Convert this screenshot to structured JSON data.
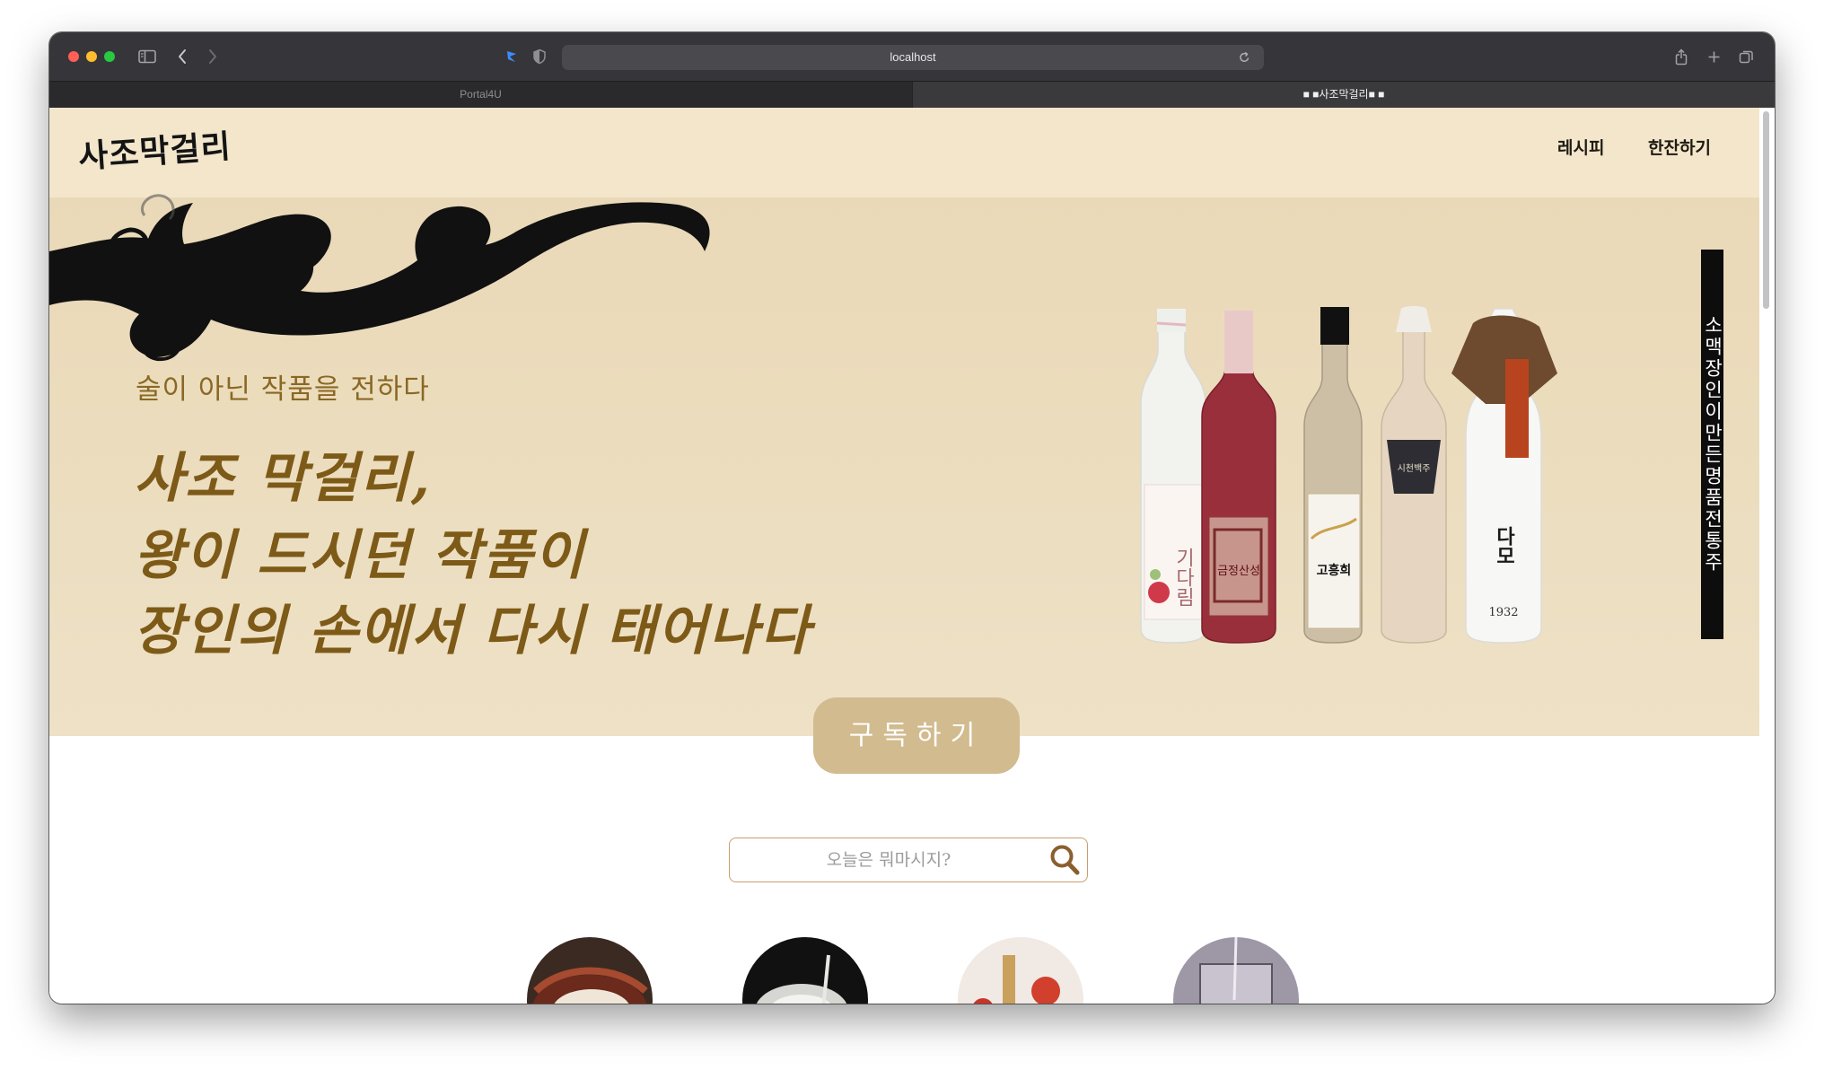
{
  "browser": {
    "url": "localhost",
    "tabs": [
      {
        "label": "Portal4U",
        "active": false
      },
      {
        "label": "■ ■사조막걸리■ ■",
        "active": true
      }
    ]
  },
  "site": {
    "logo": "사조막걸리",
    "nav": [
      {
        "label": "레시피"
      },
      {
        "label": "한잔하기"
      }
    ]
  },
  "hero": {
    "tagline": "술이 아닌 작품을 전하다",
    "headline": [
      "사조 막걸리,",
      "왕이 드시던 작품이",
      "장인의 손에서 다시 태어나다"
    ],
    "vertical_banner": "소맥장인이만든명품전통주",
    "bottle_labels": [
      "기다림",
      "금정산성",
      "고흥희",
      "시천백주",
      "1932"
    ],
    "subscribe_label": "구독하기"
  },
  "search": {
    "placeholder": "오늘은 뭐마시지?",
    "icon": "search-icon"
  },
  "categories": [
    {
      "icon": "makgeolli-bowl-photo"
    },
    {
      "icon": "pouring-cup-photo"
    },
    {
      "icon": "fruit-drinks-photo"
    },
    {
      "icon": "glass-pour-photo"
    }
  ],
  "colors": {
    "accent_gold": "#7d5a17",
    "subscribe_button": "#d1bb8f",
    "hero_background": "#ebdcbd",
    "search_border": "#c99e6f"
  }
}
